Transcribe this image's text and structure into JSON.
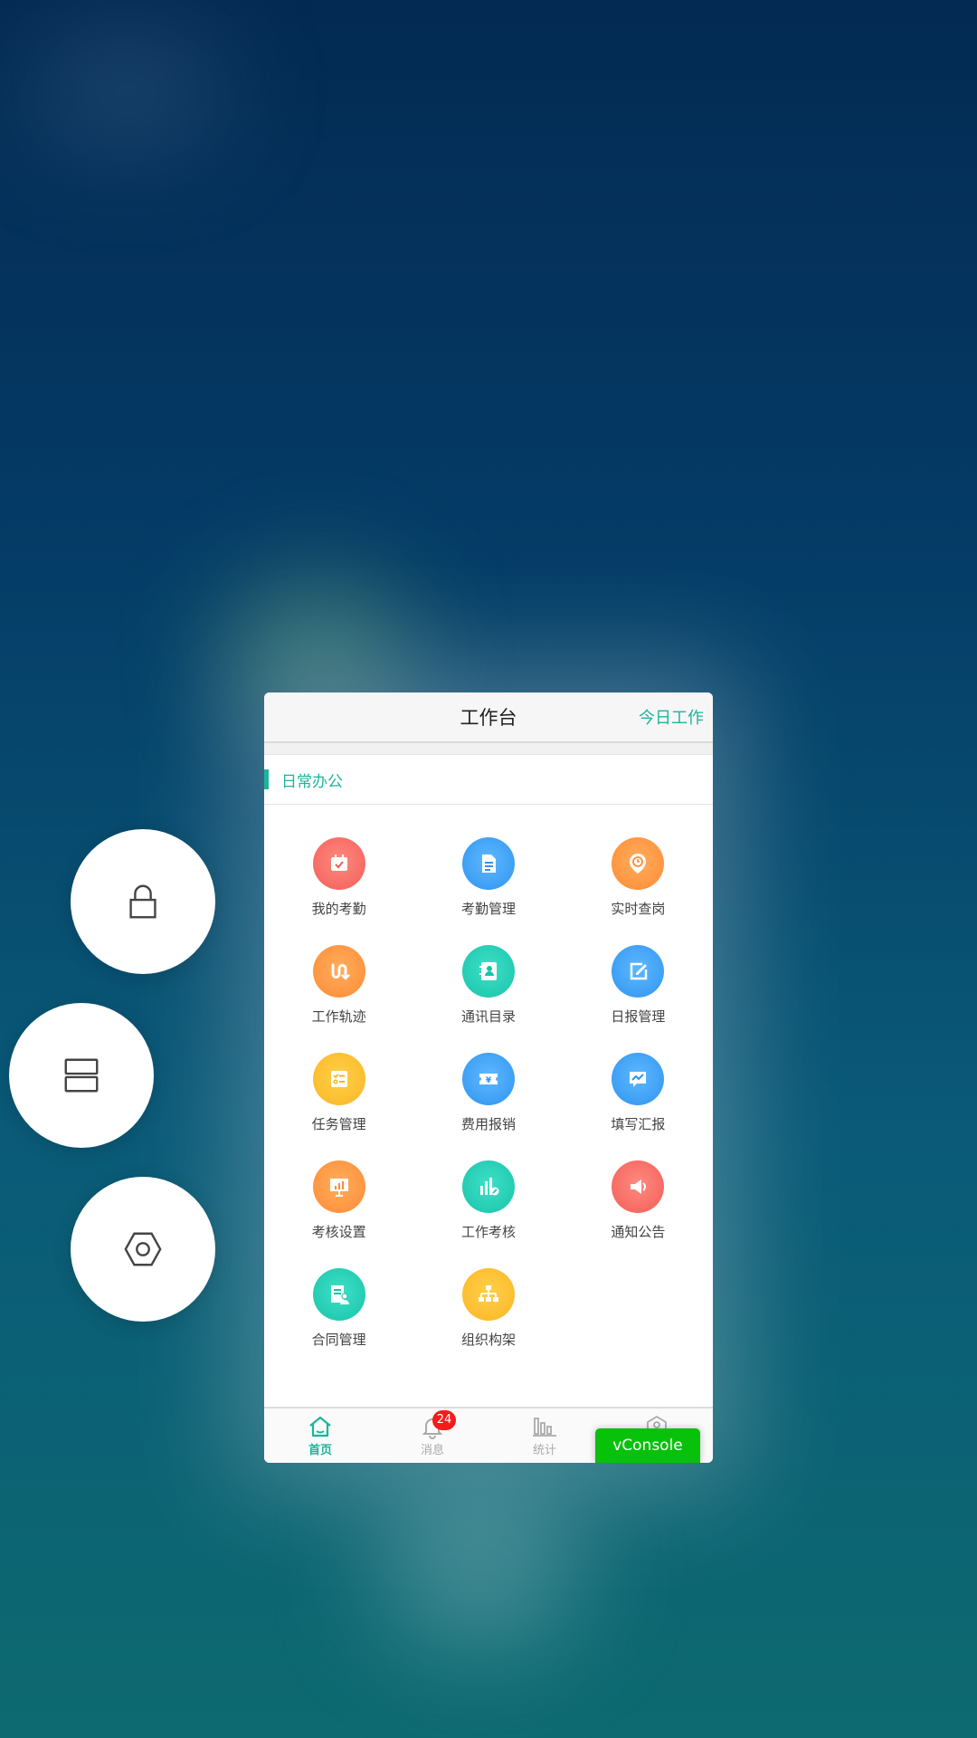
{
  "app": {
    "title": "工作台",
    "today_link": "今日工作",
    "section": "日常办公"
  },
  "grid_items": [
    {
      "label": "我的考勤",
      "icon": "calendar-check-icon",
      "color": "#f25d57"
    },
    {
      "label": "考勤管理",
      "icon": "document-icon",
      "color": "#2e94f0"
    },
    {
      "label": "实时查岗",
      "icon": "location-clock-icon",
      "color": "#ff8a35"
    },
    {
      "label": "工作轨迹",
      "icon": "route-icon",
      "color": "#ff8a35"
    },
    {
      "label": "通讯目录",
      "icon": "contacts-icon",
      "color": "#17c3a8"
    },
    {
      "label": "日报管理",
      "icon": "edit-icon",
      "color": "#2e94f0"
    },
    {
      "label": "任务管理",
      "icon": "checklist-icon",
      "color": "#fbb524"
    },
    {
      "label": "费用报销",
      "icon": "yuan-ticket-icon",
      "color": "#2e94f0"
    },
    {
      "label": "填写汇报",
      "icon": "chart-message-icon",
      "color": "#2e94f0"
    },
    {
      "label": "考核设置",
      "icon": "presentation-icon",
      "color": "#ff8a35"
    },
    {
      "label": "工作考核",
      "icon": "bar-chart-icon",
      "color": "#17c3a8"
    },
    {
      "label": "通知公告",
      "icon": "speaker-icon",
      "color": "#f25d57"
    },
    {
      "label": "合同管理",
      "icon": "contract-icon",
      "color": "#17c3a8"
    },
    {
      "label": "组织构架",
      "icon": "org-chart-icon",
      "color": "#fbb524"
    }
  ],
  "tabs": [
    {
      "label": "首页",
      "icon": "home-icon",
      "active": true
    },
    {
      "label": "消息",
      "icon": "bell-icon",
      "badge": "24"
    },
    {
      "label": "统计",
      "icon": "stats-icon"
    },
    {
      "label": "",
      "icon": "profile-icon"
    }
  ],
  "vconsole": "vConsole",
  "side_actions": [
    "lock-icon",
    "split-screen-icon",
    "settings-icon"
  ],
  "colors": {
    "accent": "#1cb49b",
    "badge": "#f21c1c",
    "vconsole": "#08c10b"
  }
}
